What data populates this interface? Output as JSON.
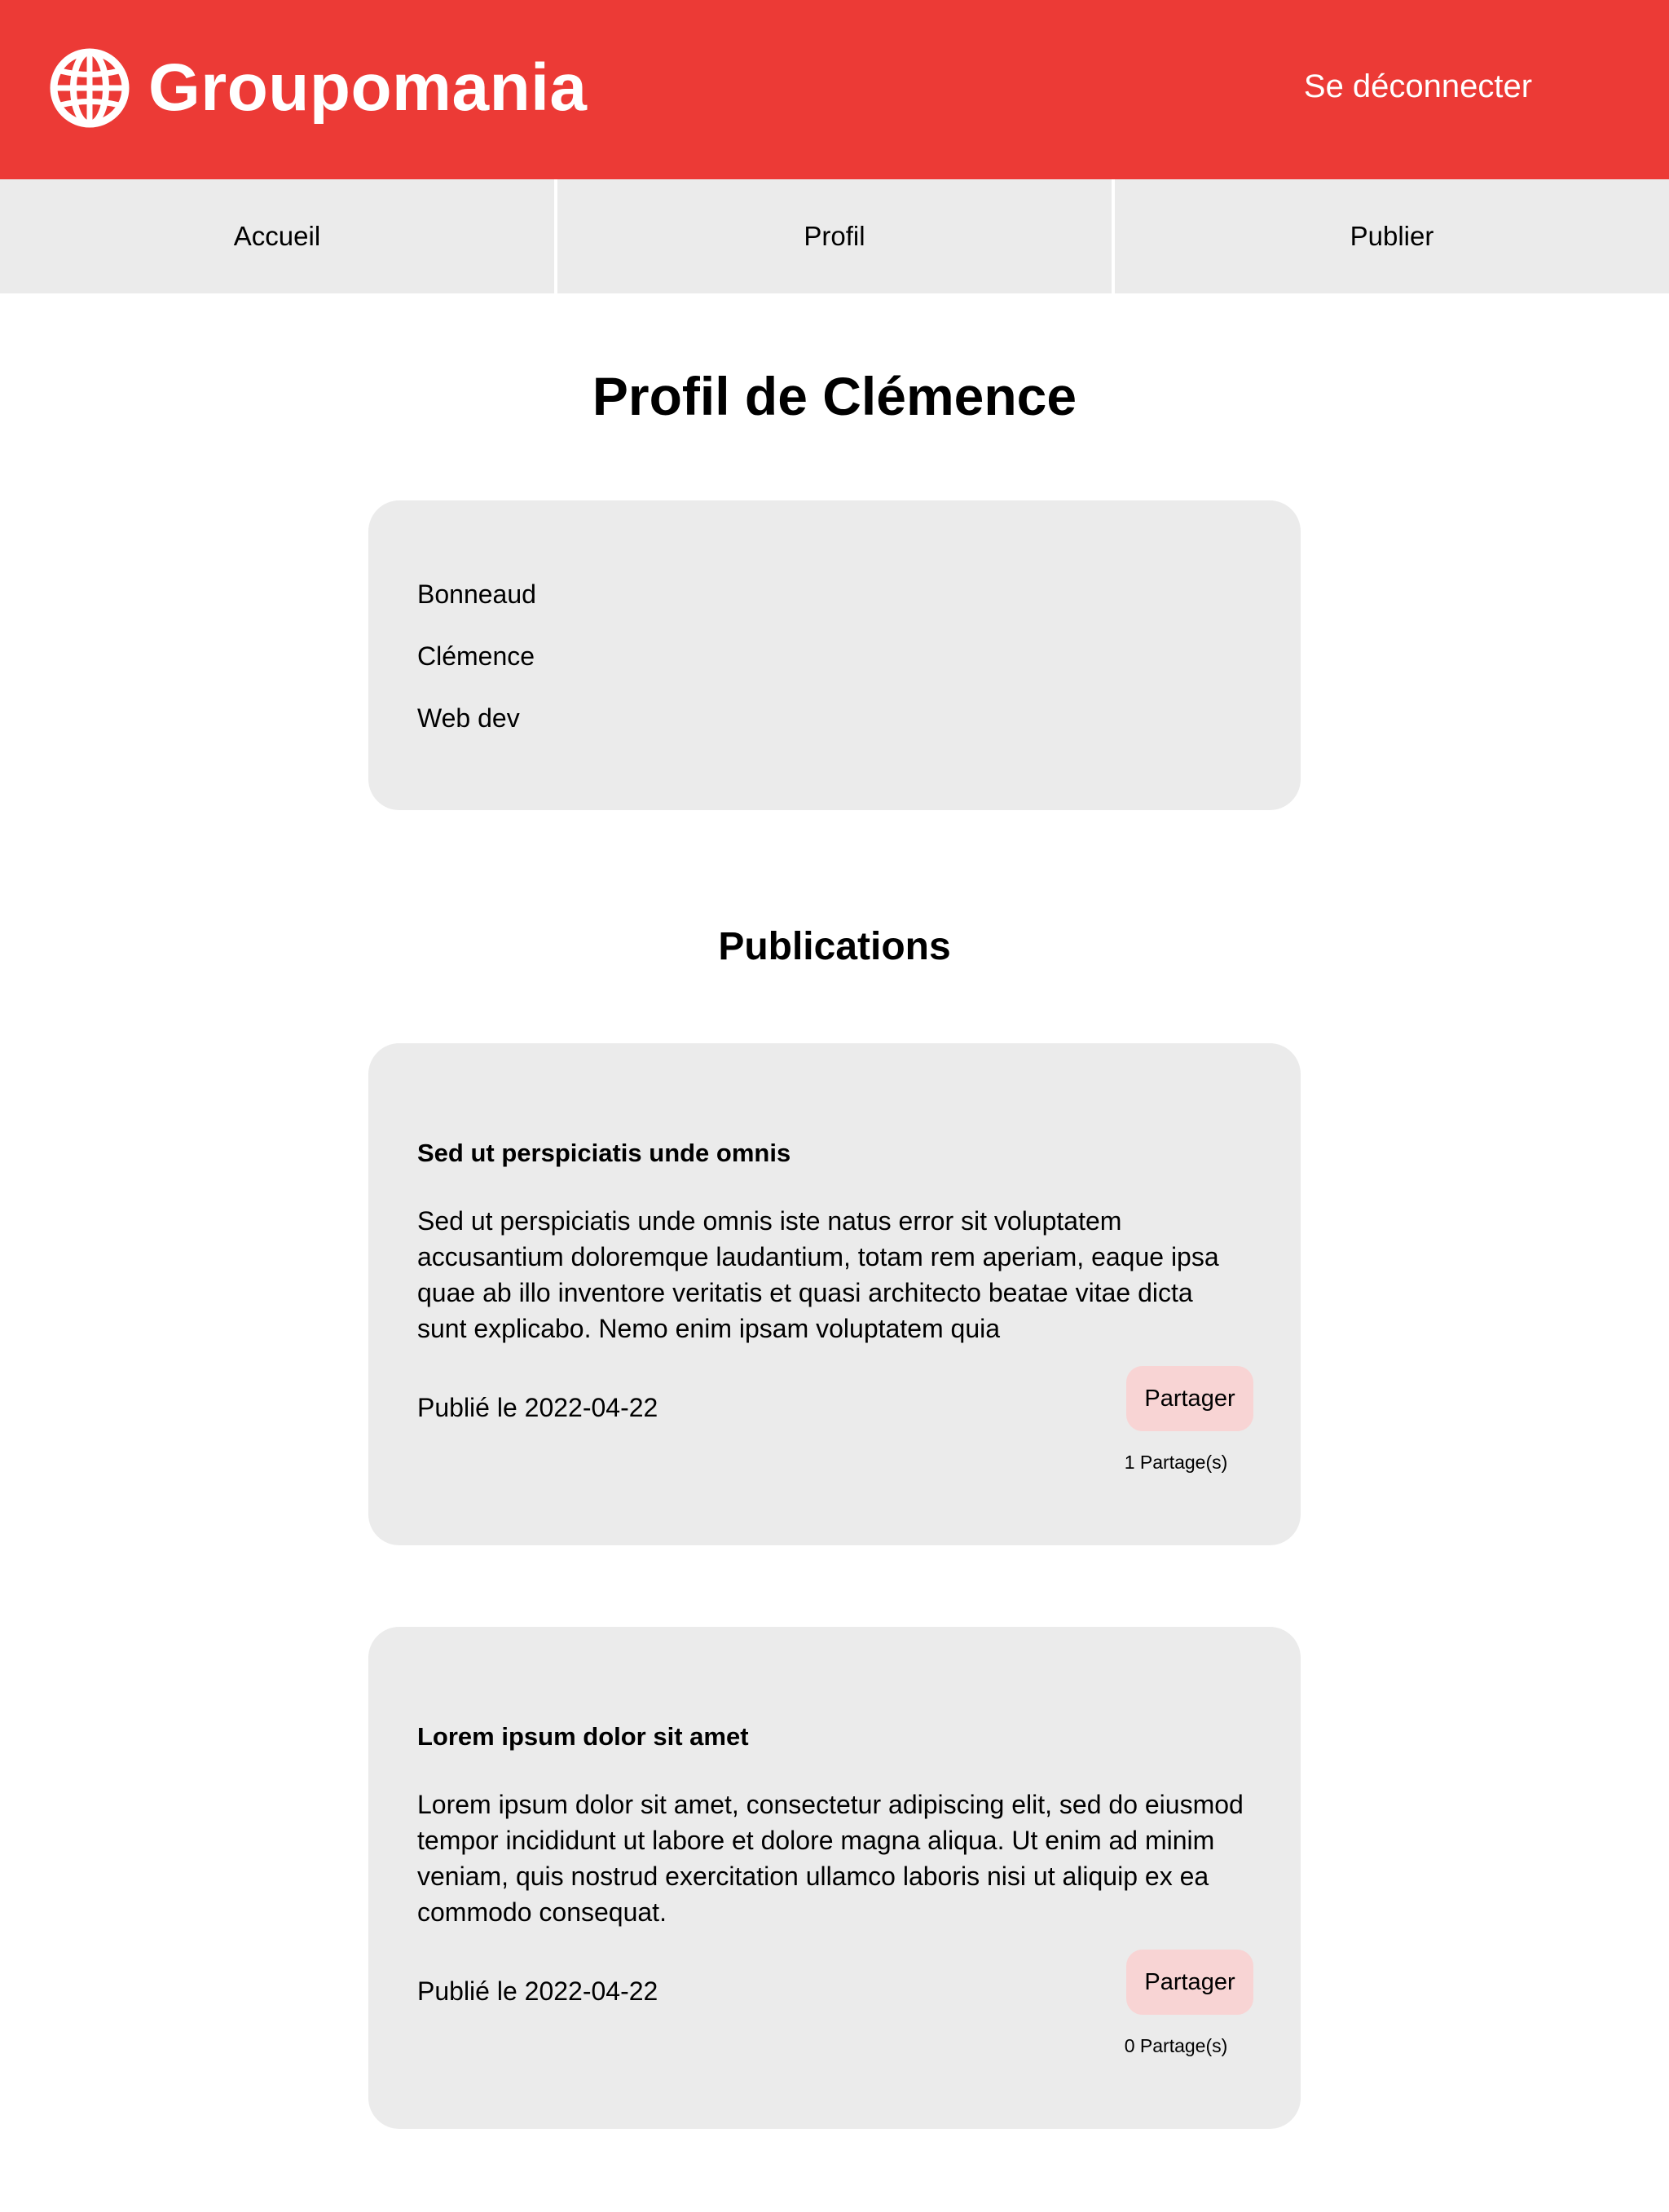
{
  "header": {
    "brand": "Groupomania",
    "logo_icon": "globe-icon",
    "logout_label": "Se déconnecter",
    "background_color": "#ec3a36",
    "text_color": "#ffffff"
  },
  "nav": {
    "items": [
      {
        "label": "Accueil"
      },
      {
        "label": "Profil"
      },
      {
        "label": "Publier"
      }
    ],
    "background_color": "#ebebeb"
  },
  "main": {
    "page_title": "Profil de Clémence",
    "profile": {
      "last_name": "Bonneaud",
      "first_name": "Clémence",
      "job": "Web dev"
    },
    "publications_title": "Publications",
    "posts": [
      {
        "title": "Sed ut perspiciatis unde omnis",
        "body": "Sed ut perspiciatis unde omnis iste natus error sit voluptatem accusantium doloremque laudantium, totam rem aperiam, eaque ipsa quae ab illo inventore veritatis et quasi architecto beatae vitae dicta sunt explicabo. Nemo enim ipsam voluptatem quia",
        "date_text": "Publié le 2022-04-22",
        "share_label": "Partager",
        "share_count": "1 Partage(s)"
      },
      {
        "title": "Lorem ipsum dolor sit amet",
        "body": "Lorem ipsum dolor sit amet, consectetur adipiscing elit, sed do eiusmod tempor incididunt ut labore et dolore magna aliqua. Ut enim ad minim veniam, quis nostrud exercitation ullamco laboris nisi ut aliquip ex ea commodo consequat.",
        "date_text": "Publié le 2022-04-22",
        "share_label": "Partager",
        "share_count": "0 Partage(s)"
      }
    ],
    "card_color": "#ebebeb",
    "share_button_color": "#f8d4d4"
  }
}
